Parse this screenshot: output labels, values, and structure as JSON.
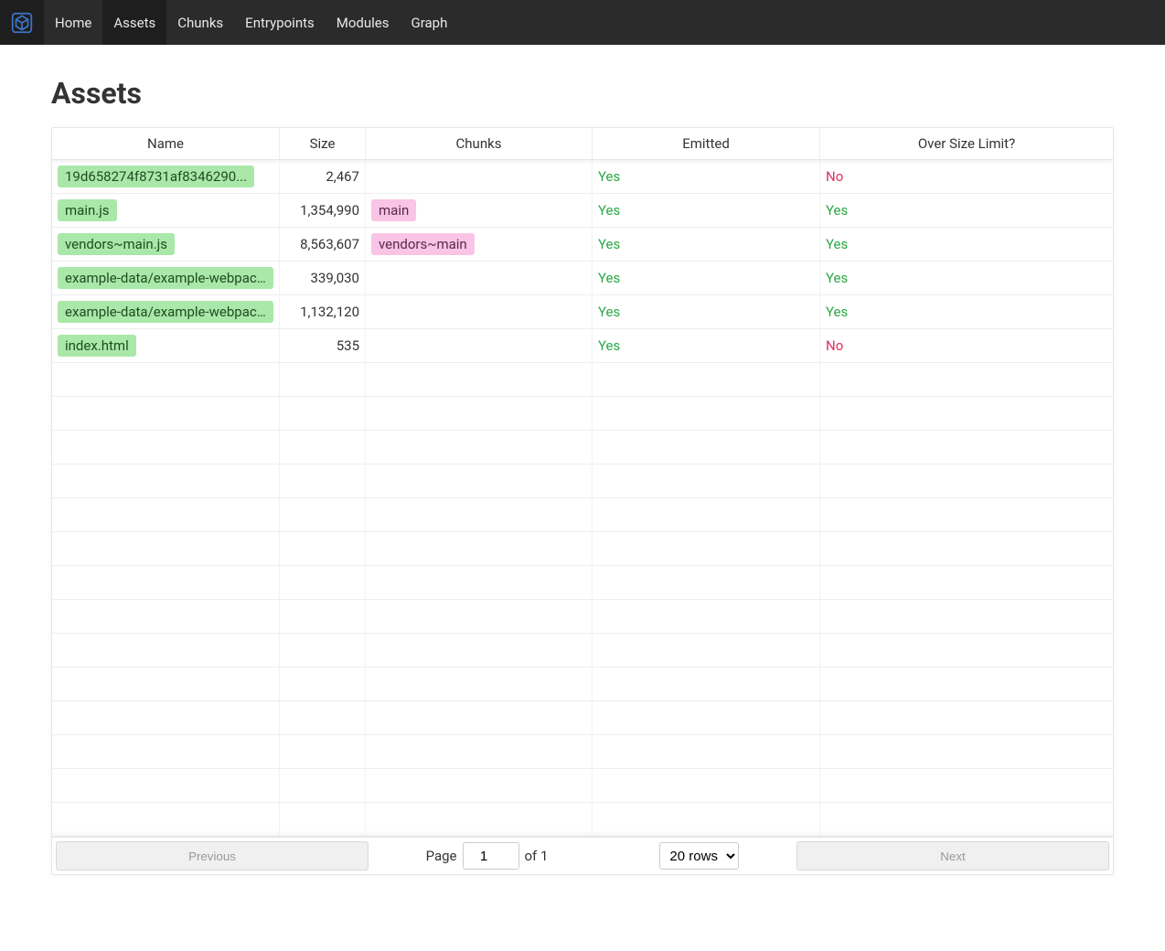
{
  "nav": {
    "items": [
      {
        "label": "Home",
        "active": false
      },
      {
        "label": "Assets",
        "active": true
      },
      {
        "label": "Chunks",
        "active": false
      },
      {
        "label": "Entrypoints",
        "active": false
      },
      {
        "label": "Modules",
        "active": false
      },
      {
        "label": "Graph",
        "active": false
      }
    ]
  },
  "page": {
    "title": "Assets"
  },
  "table": {
    "headers": {
      "name": "Name",
      "size": "Size",
      "chunks": "Chunks",
      "emitted": "Emitted",
      "over_size": "Over Size Limit?"
    },
    "total_rows": 20,
    "rows": [
      {
        "name": "19d658274f8731af8346290...",
        "size": "2,467",
        "chunks": [],
        "emitted": "Yes",
        "over_size": "No"
      },
      {
        "name": "main.js",
        "size": "1,354,990",
        "chunks": [
          "main"
        ],
        "emitted": "Yes",
        "over_size": "Yes"
      },
      {
        "name": "vendors~main.js",
        "size": "8,563,607",
        "chunks": [
          "vendors~main"
        ],
        "emitted": "Yes",
        "over_size": "Yes"
      },
      {
        "name": "example-data/example-webpac...",
        "size": "339,030",
        "chunks": [],
        "emitted": "Yes",
        "over_size": "Yes"
      },
      {
        "name": "example-data/example-webpac...",
        "size": "1,132,120",
        "chunks": [],
        "emitted": "Yes",
        "over_size": "Yes"
      },
      {
        "name": "index.html",
        "size": "535",
        "chunks": [],
        "emitted": "Yes",
        "over_size": "No"
      }
    ]
  },
  "pagination": {
    "prev_label": "Previous",
    "next_label": "Next",
    "page_label": "Page",
    "page_value": "1",
    "of_label": "of 1",
    "rows_select": "20 rows"
  }
}
